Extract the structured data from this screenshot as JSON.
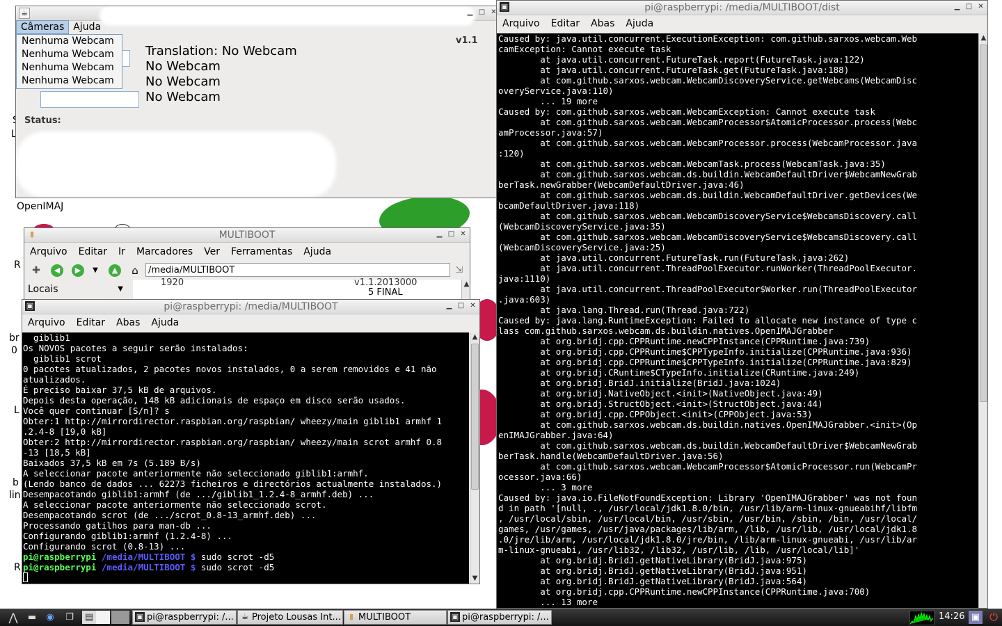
{
  "colors": {
    "terminal_bg": "#000000",
    "prompt_user": "#55ff55",
    "prompt_path": "#5c5cff",
    "raspberry_green": "#2e9e2a",
    "raspberry_red": "#c51a4a"
  },
  "desktop": {
    "partial_labels": [
      "OpenIMAJ",
      "S",
      "L",
      "R",
      "br",
      "0",
      "L",
      "b",
      "lin",
      "R"
    ]
  },
  "java_app": {
    "menu": [
      "Câmeras",
      "Ajuda"
    ],
    "camera_menu_items": [
      "Nenhuma Webcam",
      "Nenhuma Webcam",
      "Nenhuma Webcam",
      "Nenhuma Webcam"
    ],
    "version": "v1.1",
    "webcam_lines": [
      "Translation: No Webcam",
      "No Webcam",
      "No Webcam",
      "No Webcam"
    ],
    "status_label": "Status:"
  },
  "file_manager": {
    "title": "MULTIBOOT",
    "menu": [
      "Arquivo",
      "Editar",
      "Ir",
      "Marcadores",
      "Ver",
      "Ferramentas",
      "Ajuda"
    ],
    "path": "/media/MULTIBOOT",
    "side_selector": "Locais",
    "partial_row": {
      "col1": "1920",
      "col2": "v1.1.2013000",
      "col3": "5 FINAL"
    },
    "toolbar_icons": [
      "add-bookmark-icon",
      "back-icon",
      "forward-icon",
      "history-dropdown-icon",
      "up-icon",
      "home-icon",
      "go-icon"
    ]
  },
  "terminal_small": {
    "title": "pi@raspberrypi: /media/MULTIBOOT",
    "menu": [
      "Arquivo",
      "Editar",
      "Abas",
      "Ajuda"
    ],
    "lines": [
      "  giblib1",
      "Os NOVOS pacotes a seguir serão instalados:",
      "  giblib1 scrot",
      "0 pacotes atualizados, 2 pacotes novos instalados, 0 a serem removidos e 41 não",
      "atualizados.",
      "É preciso baixar 37,5 kB de arquivos.",
      "Depois desta operação, 148 kB adicionais de espaço em disco serão usados.",
      "Você quer continuar [S/n]? s",
      "Obter:1 http://mirrordirector.raspbian.org/raspbian/ wheezy/main giblib1 armhf 1",
      ".2.4-8 [19,0 kB]",
      "Obter:2 http://mirrordirector.raspbian.org/raspbian/ wheezy/main scrot armhf 0.8",
      "-13 [18,5 kB]",
      "Baixados 37,5 kB em 7s (5.189 B/s)",
      "A seleccionar pacote anteriormente não seleccionado giblib1:armhf.",
      "(Lendo banco de dados ... 62273 ficheiros e directórios actualmente instalados.)",
      "Desempacotando giblib1:armhf (de .../giblib1_1.2.4-8_armhf.deb) ...",
      "A seleccionar pacote anteriormente não seleccionado scrot.",
      "Desempacotando scrot (de .../scrot_0.8-13_armhf.deb) ...",
      "Processando gatilhos para man-db ...",
      "Configurando giblib1:armhf (1.2.4-8) ...",
      "Configurando scrot (0.8-13) ..."
    ],
    "prompts": [
      {
        "user": "pi@raspberrypi",
        "path": "/media/MULTIBOOT $",
        "cmd": " sudo scrot -d5"
      },
      {
        "user": "pi@raspberrypi",
        "path": "/media/MULTIBOOT $",
        "cmd": " sudo scrot -d5"
      }
    ]
  },
  "terminal_large": {
    "title": "pi@raspberrypi: /media/MULTIBOOT/dist",
    "menu": [
      "Arquivo",
      "Editar",
      "Abas",
      "Ajuda"
    ],
    "lines": [
      "Caused by: java.util.concurrent.ExecutionException: com.github.sarxos.webcam.Web",
      "camException: Cannot execute task",
      "        at java.util.concurrent.FutureTask.report(FutureTask.java:122)",
      "        at java.util.concurrent.FutureTask.get(FutureTask.java:188)",
      "        at com.github.sarxos.webcam.WebcamDiscoveryService.getWebcams(WebcamDisc",
      "overyService.java:110)",
      "        ... 19 more",
      "Caused by: com.github.sarxos.webcam.WebcamException: Cannot execute task",
      "        at com.github.sarxos.webcam.WebcamProcessor$AtomicProcessor.process(Webc",
      "amProcessor.java:57)",
      "        at com.github.sarxos.webcam.WebcamProcessor.process(WebcamProcessor.java",
      ":120)",
      "        at com.github.sarxos.webcam.WebcamTask.process(WebcamTask.java:35)",
      "        at com.github.sarxos.webcam.ds.buildin.WebcamDefaultDriver$WebcamNewGrab",
      "berTask.newGrabber(WebcamDefaultDriver.java:46)",
      "        at com.github.sarxos.webcam.ds.buildin.WebcamDefaultDriver.getDevices(We",
      "bcamDefaultDriver.java:118)",
      "        at com.github.sarxos.webcam.WebcamDiscoveryService$WebcamsDiscovery.call",
      "(WebcamDiscoveryService.java:35)",
      "        at com.github.sarxos.webcam.WebcamDiscoveryService$WebcamsDiscovery.call",
      "(WebcamDiscoveryService.java:25)",
      "        at java.util.concurrent.FutureTask.run(FutureTask.java:262)",
      "        at java.util.concurrent.ThreadPoolExecutor.runWorker(ThreadPoolExecutor.",
      "java:1110)",
      "        at java.util.concurrent.ThreadPoolExecutor$Worker.run(ThreadPoolExecutor",
      ".java:603)",
      "        at java.lang.Thread.run(Thread.java:722)",
      "Caused by: java.lang.RuntimeException: Failed to allocate new instance of type c",
      "lass com.github.sarxos.webcam.ds.buildin.natives.OpenIMAJGrabber",
      "        at org.bridj.cpp.CPPRuntime.newCPPInstance(CPPRuntime.java:739)",
      "        at org.bridj.cpp.CPPRuntime$CPPTypeInfo.initialize(CPPRuntime.java:936)",
      "        at org.bridj.cpp.CPPRuntime$CPPTypeInfo.initialize(CPPRuntime.java:829)",
      "        at org.bridj.CRuntime$CTypeInfo.initialize(CRuntime.java:249)",
      "        at org.bridj.BridJ.initialize(BridJ.java:1024)",
      "        at org.bridj.NativeObject.<init>(NativeObject.java:49)",
      "        at org.bridj.StructObject.<init>(StructObject.java:44)",
      "        at org.bridj.cpp.CPPObject.<init>(CPPObject.java:53)",
      "        at com.github.sarxos.webcam.ds.buildin.natives.OpenIMAJGrabber.<init>(Op",
      "enIMAJGrabber.java:64)",
      "        at com.github.sarxos.webcam.ds.buildin.WebcamDefaultDriver$WebcamNewGrab",
      "berTask.handle(WebcamDefaultDriver.java:56)",
      "        at com.github.sarxos.webcam.WebcamProcessor$AtomicProcessor.run(WebcamPr",
      "ocessor.java:66)",
      "        ... 3 more",
      "Caused by: java.io.FileNotFoundException: Library 'OpenIMAJGrabber' was not foun",
      "d in path '[null, ., /usr/local/jdk1.8.0/bin, /usr/lib/arm-linux-gnueabihf/libfm",
      ", /usr/local/sbin, /usr/local/bin, /usr/sbin, /usr/bin, /sbin, /bin, /usr/local/",
      "games, /usr/games, /usr/java/packages/lib/arm, /lib, /usr/lib, /usr/local/jdk1.8",
      ".0/jre/lib/arm, /usr/local/jdk1.8.0/jre/bin, /lib/arm-linux-gnueabi, /usr/lib/ar",
      "m-linux-gnueabi, /usr/lib32, /lib32, /usr/lib, /lib, /usr/local/lib]'",
      "        at org.bridj.BridJ.getNativeLibrary(BridJ.java:975)",
      "        at org.bridj.BridJ.getNativeLibrary(BridJ.java:951)",
      "        at org.bridj.BridJ.getNativeLibrary(BridJ.java:564)",
      "        at org.bridj.cpp.CPPRuntime.newCPPInstance(CPPRuntime.java:700)",
      "        ... 13 more"
    ]
  },
  "taskbar": {
    "tasks": [
      {
        "label": "pi@raspberrypi: /...",
        "icon": "terminal-icon"
      },
      {
        "label": "Projeto Lousas Int...",
        "icon": "java-icon"
      },
      {
        "label": "MULTIBOOT",
        "icon": "folder-icon"
      },
      {
        "label": "pi@raspberrypi: /...",
        "icon": "terminal-icon"
      }
    ],
    "clock": "14:26"
  }
}
